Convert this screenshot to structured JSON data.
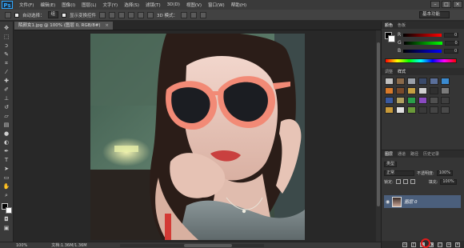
{
  "app": {
    "logo": "Ps"
  },
  "menu": [
    "文件(F)",
    "编辑(E)",
    "图像(I)",
    "图层(L)",
    "文字(Y)",
    "选择(S)",
    "滤镜(T)",
    "3D(D)",
    "视图(V)",
    "窗口(W)",
    "帮助(H)"
  ],
  "window_buttons": [
    "–",
    "□",
    "×"
  ],
  "options": {
    "auto_select_label": "自动选择：",
    "auto_select_value": "组",
    "show_transform_label": "显示变换控件",
    "mode_3d_label": "3D 模式：",
    "workspace": "基本功能"
  },
  "document": {
    "tab_title": "陌颜女1.jpg @ 100% (图层 0, RGB/8#)",
    "close": "×"
  },
  "statusbar": {
    "zoom": "100%",
    "doc_info": "文档:1.36M/1.36M"
  },
  "color_panel": {
    "tabs": [
      "颜色",
      "色板"
    ],
    "channels": [
      {
        "label": "R",
        "value": "0"
      },
      {
        "label": "G",
        "value": "0"
      },
      {
        "label": "B",
        "value": "0"
      }
    ]
  },
  "adjustments_panel": {
    "tabs": [
      "调整",
      "样式"
    ]
  },
  "layers_panel": {
    "tabs": [
      "图层",
      "通道",
      "路径",
      "历史记录"
    ],
    "kind_label": "类型",
    "blend_mode": "正常",
    "opacity_label": "不透明度:",
    "opacity_value": "100%",
    "lock_label": "锁定:",
    "fill_label": "填充:",
    "fill_value": "100%",
    "layer_name": "图层 0",
    "eye": "◉"
  },
  "colors": {
    "accent": "#31a8ff",
    "selected_layer": "#4b5f7c",
    "highlight_ring": "#e21b1b"
  }
}
